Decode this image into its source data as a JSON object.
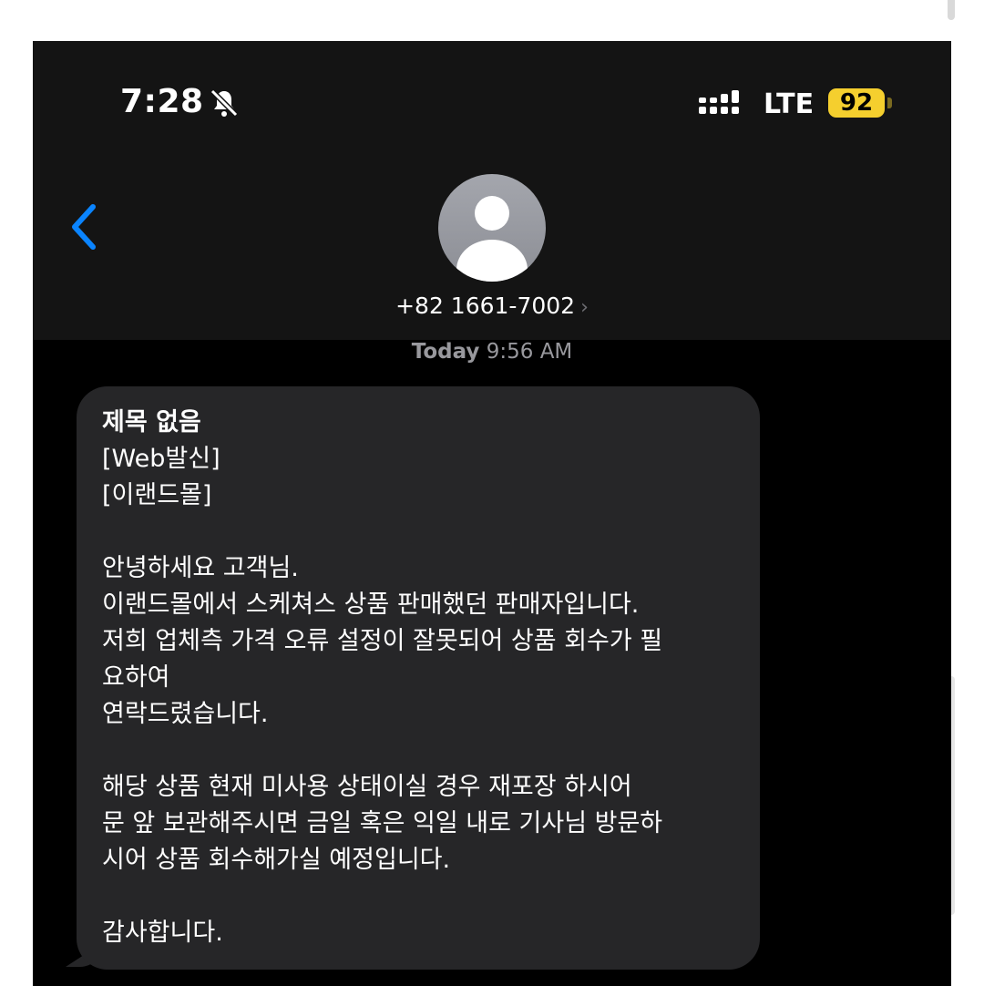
{
  "status_bar": {
    "time": "7:28",
    "network": "LTE",
    "battery_level": "92",
    "icons": [
      "bell-slash-icon",
      "signal-icon",
      "battery-icon"
    ],
    "battery_color": "#f5cf2e"
  },
  "header": {
    "back_icon": "chevron-left-icon",
    "contact": "+82 1661-7002",
    "contact_chevron": "›"
  },
  "conversation": {
    "timestamp_day": "Today",
    "timestamp_time": "9:56 AM",
    "message": {
      "subject": "제목 없음",
      "body": "[Web발신]\n[이랜드몰]\n\n안녕하세요 고객님.\n이랜드몰에서 스케쳐스 상품 판매했던 판매자입니다.\n저희 업체측 가격 오류 설정이 잘못되어 상품 회수가 필\n요하여\n연락드렸습니다.\n\n해당 상품 현재 미사용 상태이실 경우 재포장 하시어\n문 앞 보관해주시면 금일 혹은 익일 내로 기사님 방문하\n시어 상품 회수해가실 예정입니다.\n\n감사합니다."
    }
  },
  "colors": {
    "accent": "#0a84ff",
    "bubble": "#262628",
    "background": "#000000"
  }
}
